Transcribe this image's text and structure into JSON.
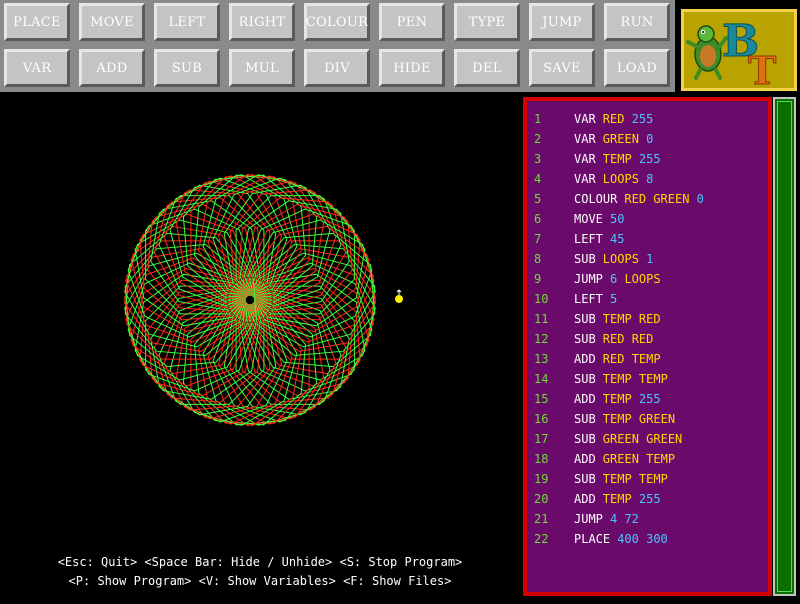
{
  "toolbar": {
    "row1": [
      "PLACE",
      "MOVE",
      "LEFT",
      "RIGHT",
      "COLOUR",
      "PEN",
      "TYPE",
      "JUMP",
      "RUN"
    ],
    "row2": [
      "VAR",
      "ADD",
      "SUB",
      "MUL",
      "DIV",
      "HIDE",
      "DEL",
      "SAVE",
      "LOAD"
    ]
  },
  "logo": {
    "letters": "BT"
  },
  "footer": {
    "line1": "<Esc: Quit> <Space Bar: Hide / Unhide> <S: Stop Program>",
    "line2": "<P: Show Program> <V: Show Variables> <F: Show Files>"
  },
  "program": [
    {
      "n": "1",
      "cmd": "VAR",
      "args": [
        [
          "v",
          "RED"
        ],
        [
          "n",
          "255"
        ]
      ]
    },
    {
      "n": "2",
      "cmd": "VAR",
      "args": [
        [
          "v",
          "GREEN"
        ],
        [
          "n",
          "0"
        ]
      ]
    },
    {
      "n": "3",
      "cmd": "VAR",
      "args": [
        [
          "v",
          "TEMP"
        ],
        [
          "n",
          "255"
        ]
      ]
    },
    {
      "n": "4",
      "cmd": "VAR",
      "args": [
        [
          "v",
          "LOOPS"
        ],
        [
          "n",
          "8"
        ]
      ]
    },
    {
      "n": "5",
      "cmd": "COLOUR",
      "args": [
        [
          "v",
          "RED"
        ],
        [
          "v",
          "GREEN"
        ],
        [
          "n",
          "0"
        ]
      ]
    },
    {
      "n": "6",
      "cmd": "MOVE",
      "args": [
        [
          "n",
          "50"
        ]
      ]
    },
    {
      "n": "7",
      "cmd": "LEFT",
      "args": [
        [
          "n",
          "45"
        ]
      ]
    },
    {
      "n": "8",
      "cmd": "SUB",
      "args": [
        [
          "v",
          "LOOPS"
        ],
        [
          "n",
          "1"
        ]
      ]
    },
    {
      "n": "9",
      "cmd": "JUMP",
      "args": [
        [
          "n",
          "6"
        ],
        [
          "v",
          "LOOPS"
        ]
      ]
    },
    {
      "n": "10",
      "cmd": "LEFT",
      "args": [
        [
          "n",
          "5"
        ]
      ]
    },
    {
      "n": "11",
      "cmd": "SUB",
      "args": [
        [
          "v",
          "TEMP"
        ],
        [
          "v",
          "RED"
        ]
      ]
    },
    {
      "n": "12",
      "cmd": "SUB",
      "args": [
        [
          "v",
          "RED"
        ],
        [
          "v",
          "RED"
        ]
      ]
    },
    {
      "n": "13",
      "cmd": "ADD",
      "args": [
        [
          "v",
          "RED"
        ],
        [
          "v",
          "TEMP"
        ]
      ]
    },
    {
      "n": "14",
      "cmd": "SUB",
      "args": [
        [
          "v",
          "TEMP"
        ],
        [
          "v",
          "TEMP"
        ]
      ]
    },
    {
      "n": "15",
      "cmd": "ADD",
      "args": [
        [
          "v",
          "TEMP"
        ],
        [
          "n",
          "255"
        ]
      ]
    },
    {
      "n": "16",
      "cmd": "SUB",
      "args": [
        [
          "v",
          "TEMP"
        ],
        [
          "v",
          "GREEN"
        ]
      ]
    },
    {
      "n": "17",
      "cmd": "SUB",
      "args": [
        [
          "v",
          "GREEN"
        ],
        [
          "v",
          "GREEN"
        ]
      ]
    },
    {
      "n": "18",
      "cmd": "ADD",
      "args": [
        [
          "v",
          "GREEN"
        ],
        [
          "v",
          "TEMP"
        ]
      ]
    },
    {
      "n": "19",
      "cmd": "SUB",
      "args": [
        [
          "v",
          "TEMP"
        ],
        [
          "v",
          "TEMP"
        ]
      ]
    },
    {
      "n": "20",
      "cmd": "ADD",
      "args": [
        [
          "v",
          "TEMP"
        ],
        [
          "n",
          "255"
        ]
      ]
    },
    {
      "n": "21",
      "cmd": "JUMP",
      "args": [
        [
          "n",
          "4"
        ],
        [
          "n",
          "72"
        ]
      ]
    },
    {
      "n": "22",
      "cmd": "PLACE",
      "args": [
        [
          "n",
          "400"
        ],
        [
          "n",
          "300"
        ]
      ]
    }
  ],
  "colors": {
    "line_number": "#6fdc3a",
    "command": "#ffffff",
    "variable": "#ffd700",
    "number": "#4fc3ff",
    "panel_bg": "#6a0a6a",
    "panel_border": "#d40000",
    "drawing_red": "#ff2a1a",
    "drawing_green": "#3cff3c",
    "turtle": "#ffee00"
  },
  "icons": {
    "logo": "turtle-mascot-icon",
    "turtle": "turtle-cursor-icon"
  }
}
